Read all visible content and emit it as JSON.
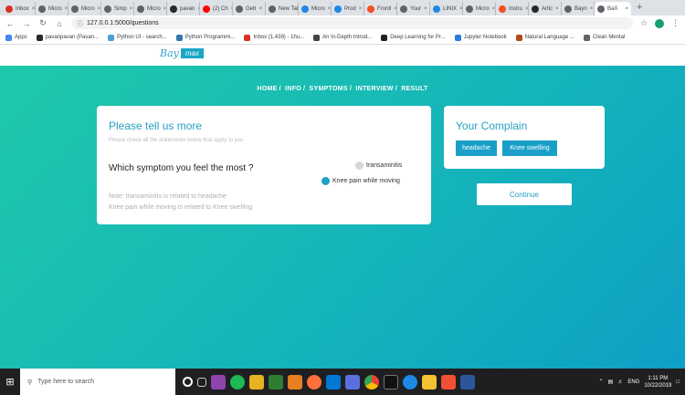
{
  "browser": {
    "tabs": [
      {
        "label": "Inbox",
        "color": "#d93025"
      },
      {
        "label": "Micro",
        "color": "#5f6368"
      },
      {
        "label": "Micro",
        "color": "#5f6368"
      },
      {
        "label": "Simp",
        "color": "#5f6368"
      },
      {
        "label": "Micro",
        "color": "#5f6368"
      },
      {
        "label": "pavan",
        "color": "#24292e"
      },
      {
        "label": "(2) Ch",
        "color": "#ff0000"
      },
      {
        "label": "Gett",
        "color": "#5f6368"
      },
      {
        "label": "New Tab",
        "color": "#5f6368"
      },
      {
        "label": "Micro",
        "color": "#1e88e5"
      },
      {
        "label": "Prod",
        "color": "#1e88e5"
      },
      {
        "label": "Frontl",
        "color": "#f25022"
      },
      {
        "label": "Your",
        "color": "#5f6368"
      },
      {
        "label": "LINIX",
        "color": "#1e88e5"
      },
      {
        "label": "Micro",
        "color": "#5f6368"
      },
      {
        "label": "Instru",
        "color": "#f25022"
      },
      {
        "label": "Artic",
        "color": "#24292e"
      },
      {
        "label": "Bayn",
        "color": "#5f6368"
      },
      {
        "label": "BaX",
        "color": "#5f6368",
        "active": true
      }
    ],
    "new_tab": "+",
    "url": "127.0.0.1:5000/questions",
    "bookmarks": [
      {
        "label": "Apps",
        "color": "#4285f4"
      },
      {
        "label": "pavanpavan (Pavan...",
        "color": "#24292e"
      },
      {
        "label": "Python UI - search...",
        "color": "#4a9fd8"
      },
      {
        "label": "Python Programmi...",
        "color": "#3776ab"
      },
      {
        "label": "Inbox (1,439) - 1hu...",
        "color": "#d93025"
      },
      {
        "label": "An In-Depth Introd...",
        "color": "#444"
      },
      {
        "label": "Deep Learning for Pr...",
        "color": "#222"
      },
      {
        "label": "Jupyter Notebook",
        "color": "#2a7cd8"
      },
      {
        "label": "Natural Language ...",
        "color": "#b04a1a"
      },
      {
        "label": "Clean Mental",
        "color": "#5f6368"
      }
    ]
  },
  "site": {
    "logo_part1": "Bay",
    "logo_part2": "max",
    "breadcrumb": [
      "HOME",
      "INFO",
      "SYMPTOMS",
      "INTERVIEW",
      "RESULT"
    ],
    "main_card": {
      "title": "Please tell us more",
      "hint": "Please check all the statements below that apply to you",
      "question": "Which symptom you feel the most ?",
      "options": [
        "transaminitis",
        "Knee pain while moving"
      ],
      "notes": [
        "Note: transaminitis is related to headache",
        "Knee pain while moving is related to Knee swelling"
      ]
    },
    "side_card": {
      "title": "Your Complain",
      "chips": [
        "headache",
        "Knee swelling"
      ]
    },
    "continue_label": "Continue"
  },
  "taskbar": {
    "search_placeholder": "Type here to search",
    "time": "1:11 PM",
    "date": "10/22/2019",
    "lang": "ENG"
  }
}
